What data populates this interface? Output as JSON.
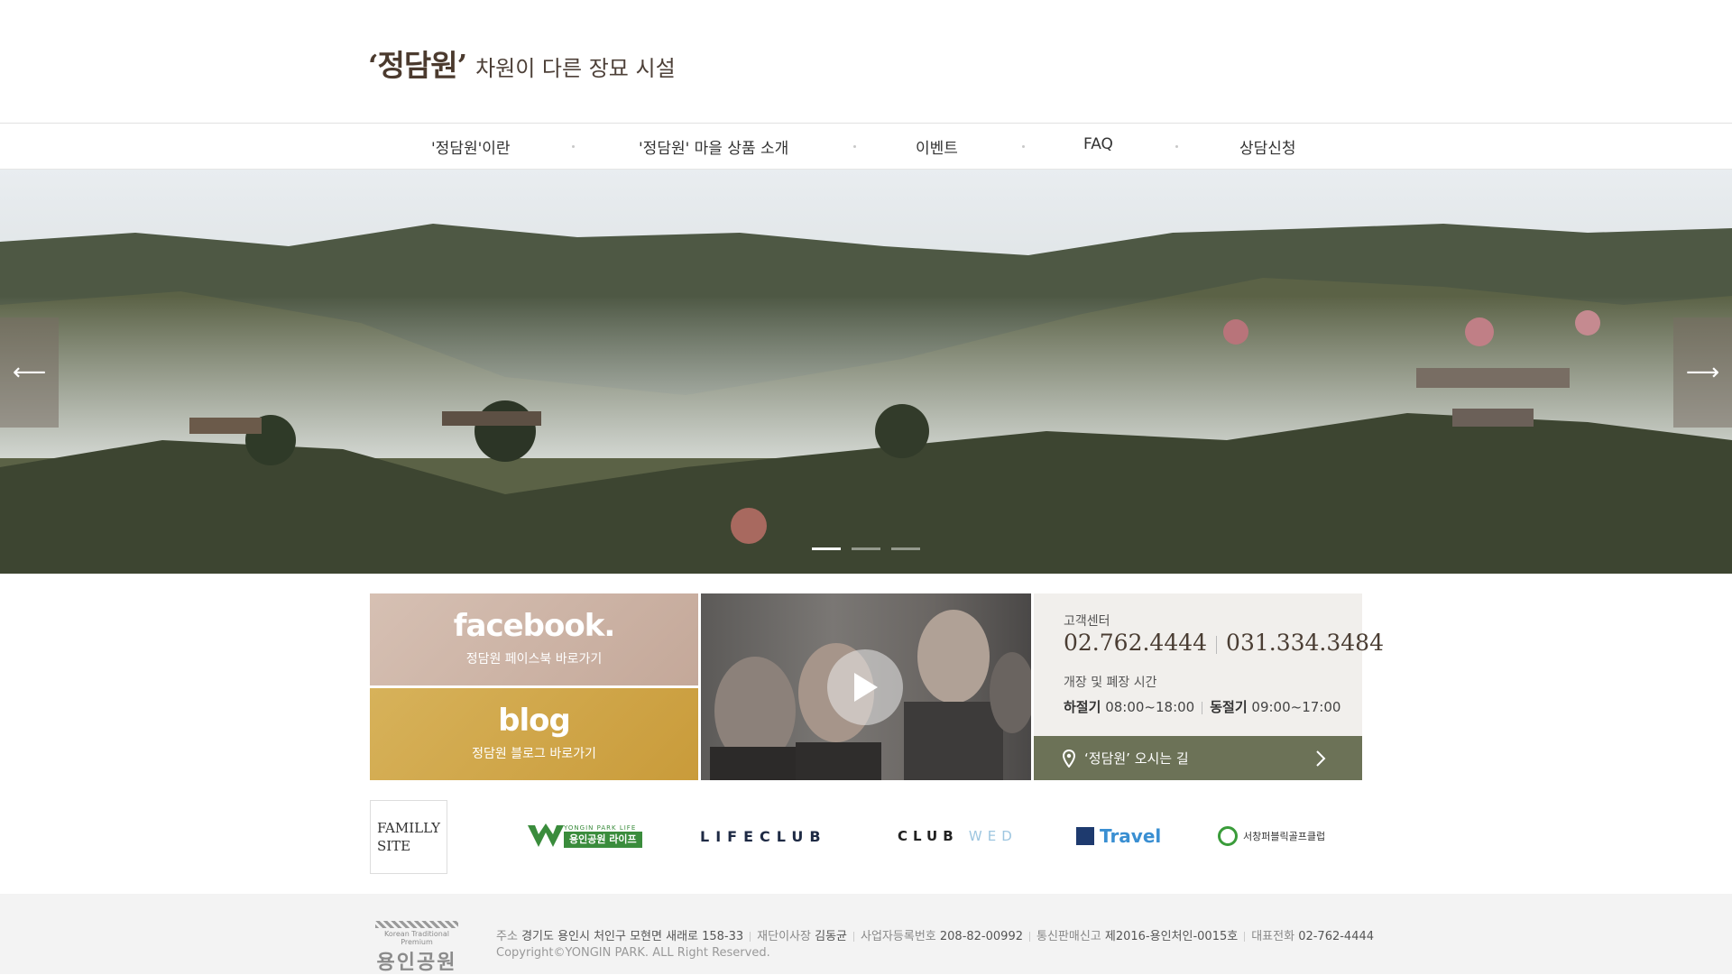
{
  "header": {
    "brand": "‘정담원’",
    "tagline": "차원이 다른 장묘 시설"
  },
  "nav": {
    "items": [
      "'정담원'이란",
      "'정담원' 마을 상품 소개",
      "이벤트",
      "FAQ",
      "상담신청"
    ]
  },
  "hero": {
    "prev_label": "⟵",
    "next_label": "⟶",
    "slide_count": 3,
    "active_slide": 1
  },
  "tiles": {
    "facebook": {
      "title": "facebook.",
      "subtitle": "정담원 페이스북 바로가기"
    },
    "blog": {
      "title": "blog",
      "subtitle": "정담원 블로그 바로가기"
    },
    "video": {
      "icon": "play-icon"
    },
    "info": {
      "cs_label": "고객센터",
      "phone1": "02.762.4444",
      "phone2": "031.334.3484",
      "hours_label": "개장 및 폐장 시간",
      "summer_label": "하절기",
      "summer_hours": "08:00~18:00",
      "winter_label": "동절기",
      "winter_hours": "09:00~17:00",
      "directions": "‘정담원’ 오시는 길"
    }
  },
  "family": {
    "label_line1": "FAMILLY",
    "label_line2": "SITE",
    "yongin_small": "YONGIN PARK LIFE",
    "yongin_main": "용인공원 라이프",
    "lifeclub": "LIFECLUB",
    "clubwed_club": "CLUB",
    "clubwed_wed": "WED",
    "travel": "Travel",
    "seochang": "서창퍼블릭골프클럽"
  },
  "footer": {
    "logo_small": "Korean Traditional Premium",
    "logo_main": "용인공원",
    "address_label": "주소",
    "address": "경기도 용인시 처인구 모현면 새래로 158-33",
    "ceo_label": "재단이사장",
    "ceo": "김동균",
    "bizno_label": "사업자등록번호",
    "bizno": "208-82-00992",
    "mailorder_label": "통신판매신고",
    "mailorder": "제2016-용인처인-0015호",
    "tel_label": "대표전화",
    "tel": "02-762-4444",
    "copyright": "Copyright©YONGIN PARK. ALL Right Reserved."
  },
  "colors": {
    "brand_brown": "#4b3a2e",
    "directions_bg": "#6c7257",
    "facebook_bg": "#c9ad9e",
    "blog_bg": "#d1a84c"
  }
}
